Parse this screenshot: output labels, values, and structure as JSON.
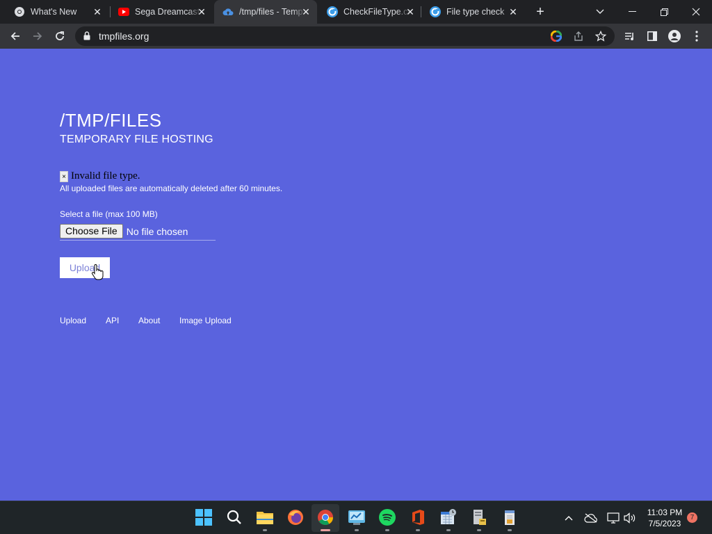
{
  "browser": {
    "tabs": [
      {
        "title": "What's New",
        "icon": "chrome-icon",
        "active": false
      },
      {
        "title": "Sega Dreamcast",
        "icon": "youtube-icon",
        "active": false
      },
      {
        "title": "/tmp/files - Temp",
        "icon": "cloud-upload-icon",
        "active": true
      },
      {
        "title": "CheckFileType.com",
        "icon": "checkfiletype-icon",
        "active": false
      },
      {
        "title": "File type check",
        "icon": "checkfiletype-icon",
        "active": false
      }
    ],
    "url": "tmpfiles.org"
  },
  "page": {
    "title": "/TMP/FILES",
    "subtitle": "TEMPORARY FILE HOSTING",
    "alert": {
      "close_glyph": "×",
      "message": "Invalid file type."
    },
    "notice": "All uploaded files are automatically deleted after 60 minutes.",
    "file_label": "Select a file (max 100 MB)",
    "choose_button": "Choose File",
    "no_file_text": "No file chosen",
    "upload_button": "Upload",
    "footer_links": [
      "Upload",
      "API",
      "About",
      "Image Upload"
    ]
  },
  "taskbar": {
    "apps": [
      "start-icon",
      "search-icon",
      "file-explorer-icon",
      "firefox-icon",
      "chrome-icon",
      "control-panel-icon",
      "spotify-icon",
      "office-icon",
      "calendar-app-icon",
      "printer-app-icon",
      "notepad-app-icon"
    ],
    "time": "11:03 PM",
    "date": "7/5/2023",
    "notification_count": "7"
  },
  "colors": {
    "page_background": "#5a63de",
    "alert_text": "#000000",
    "upload_button_text": "#7d82d8"
  }
}
